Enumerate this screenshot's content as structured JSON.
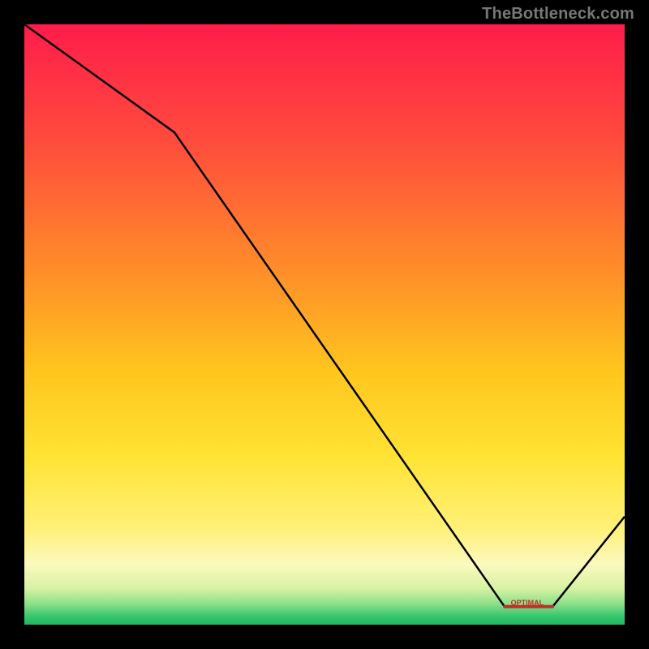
{
  "watermark": "TheBottleneck.com",
  "optimal_label": "OPTIMAL",
  "chart_data": {
    "type": "line",
    "title": "",
    "xlabel": "",
    "ylabel": "",
    "xlim": [
      0,
      100
    ],
    "ylim": [
      0,
      100
    ],
    "x": [
      0,
      25,
      80,
      88,
      100
    ],
    "values": [
      100,
      82,
      3,
      3,
      18
    ],
    "optimal_range": [
      80,
      88
    ],
    "gradient_stops": [
      {
        "pos": 0.0,
        "color": "#ff1c4b"
      },
      {
        "pos": 0.2,
        "color": "#ff4d3c"
      },
      {
        "pos": 0.4,
        "color": "#ff8a2a"
      },
      {
        "pos": 0.58,
        "color": "#ffc61e"
      },
      {
        "pos": 0.72,
        "color": "#ffe334"
      },
      {
        "pos": 0.84,
        "color": "#fff178"
      },
      {
        "pos": 0.9,
        "color": "#fbf9be"
      },
      {
        "pos": 0.94,
        "color": "#d6f2a3"
      },
      {
        "pos": 0.965,
        "color": "#8fe08a"
      },
      {
        "pos": 0.985,
        "color": "#3cc76f"
      },
      {
        "pos": 1.0,
        "color": "#1cb860"
      }
    ],
    "line_color": "#000000",
    "optimal_marker_color": "#c03028"
  }
}
